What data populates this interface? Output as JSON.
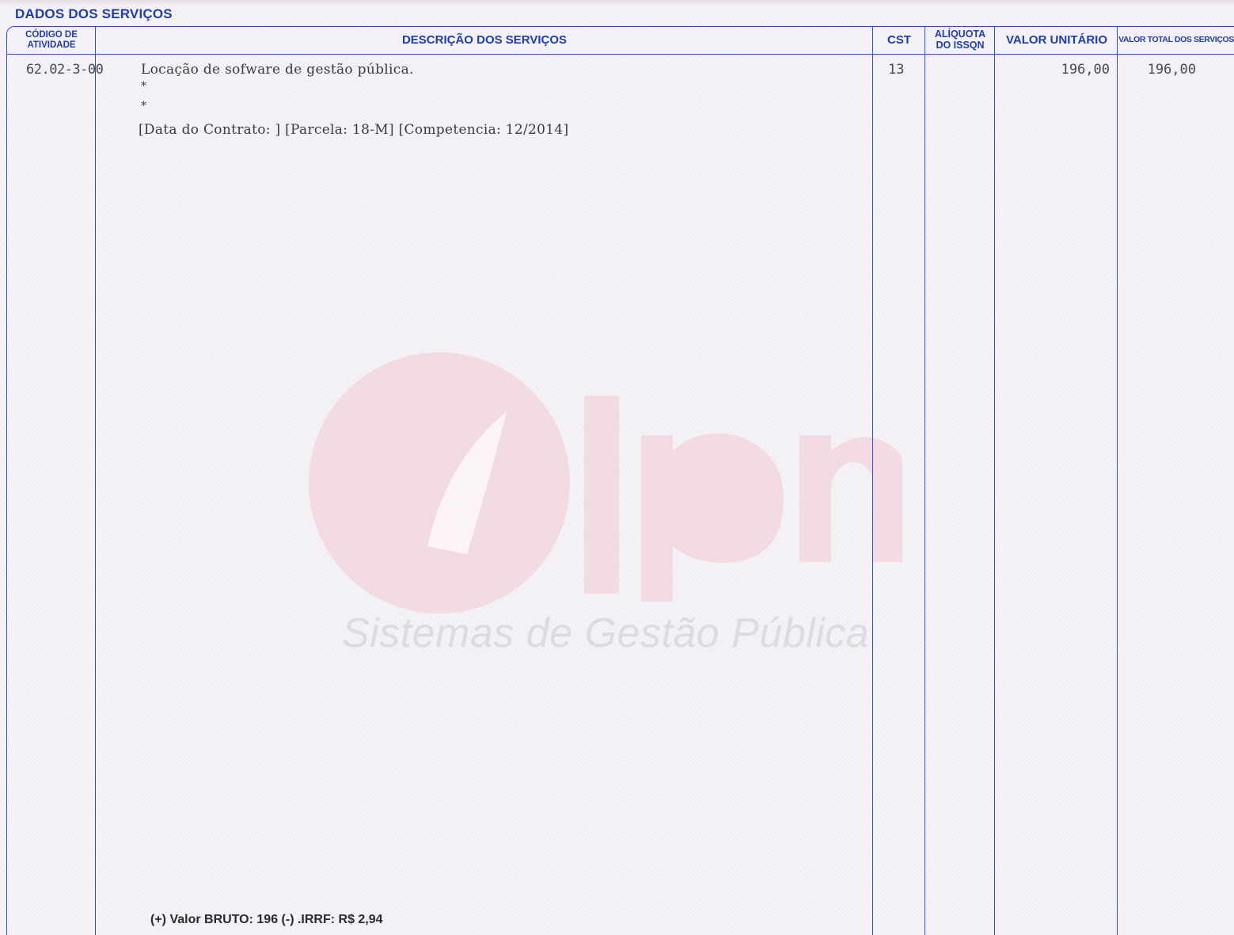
{
  "section": {
    "title": "DADOS DOS SERVIÇOS"
  },
  "table": {
    "headers": {
      "code_line1": "CÓDIGO DE",
      "code_line2": "ATIVIDADE",
      "description": "DESCRIÇÃO DOS SERVIÇOS",
      "cst": "CST",
      "aliquota_line1": "ALÍQUOTA",
      "aliquota_line2": "DO ISSQN",
      "unit_value": "VALOR UNITÁRIO",
      "total_value": "VALOR TOTAL DOS SERVIÇOS"
    },
    "row": {
      "code": "62.02-3-00",
      "description": "Locação de sofware de gestão pública.",
      "star1": "*",
      "star2": "*",
      "meta": "[Data do Contrato: ]  [Parcela: 18-M]  [Competencia: 12/2014]",
      "cst": "13",
      "aliquota": "",
      "unit_value": "196,00",
      "total_value": "196,00"
    },
    "footer_note": "(+) Valor BRUTO: 196 (-) .IRRF: R$ 2,94"
  },
  "watermark": {
    "logo_text": "Ipm",
    "tagline": "Sistemas de Gestão Pública"
  },
  "colors": {
    "ink_blue": "#1f3ea8",
    "rule_blue": "#2c4fbf",
    "watermark_pink": "#f2d3dc"
  }
}
